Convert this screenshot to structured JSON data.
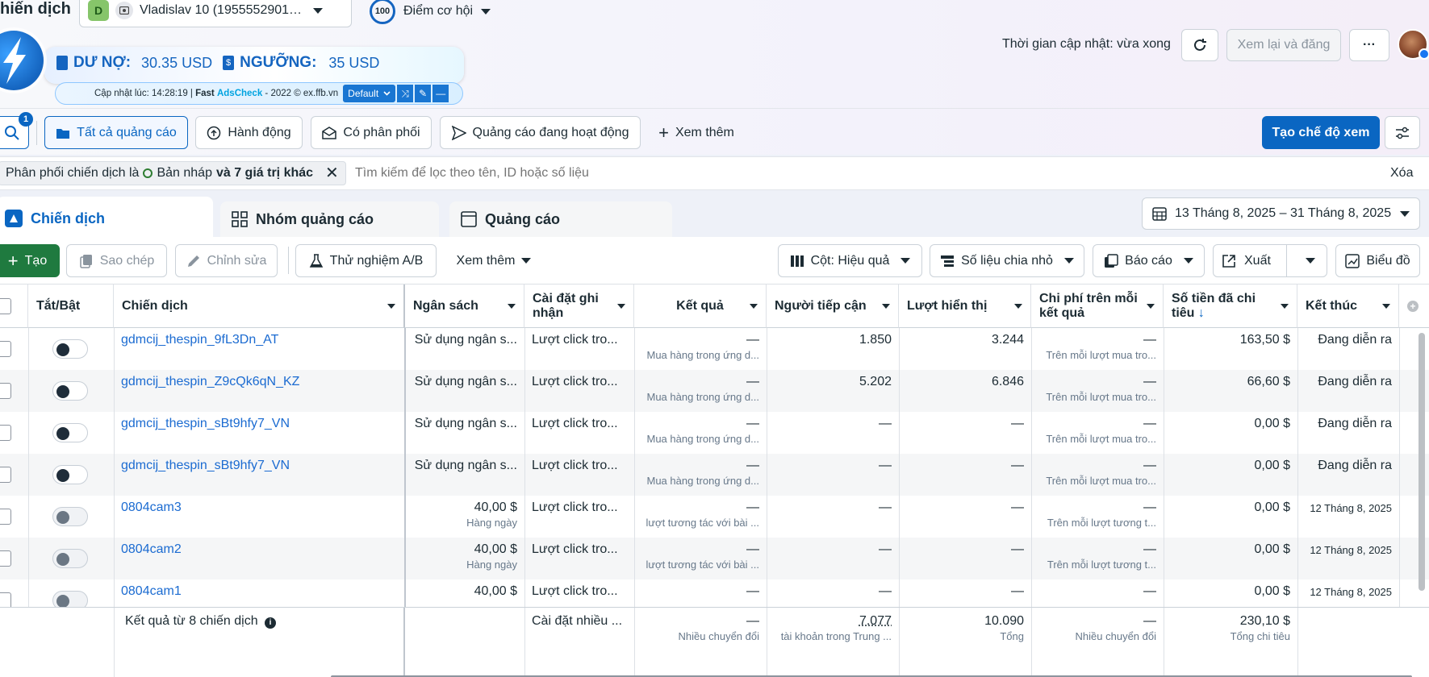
{
  "header": {
    "page_title": "hiến dịch",
    "account_badge": "D",
    "account_name": "Vladislav 10 (1955552901…",
    "score_value": "100",
    "score_label": "Điểm cơ hội",
    "update_time": "Thời gian cập nhật: vừa xong",
    "review_publish": "Xem lại và đăng",
    "more": "···"
  },
  "widget": {
    "debt_label": "DƯ NỢ:",
    "debt_value": "30.35 USD",
    "limit_label": "NGƯỠNG:",
    "limit_value": "35 USD",
    "footer_prefix": "Cập nhật lúc: 14:28:19 | ",
    "footer_fast": "Fast",
    "footer_brand": "AdsCheck",
    "footer_suffix": " - 2022 © ex.ffb.vn",
    "select_value": "Default"
  },
  "filters": {
    "search_badge": "1",
    "all_ads": "Tất cả quảng cáo",
    "actions": "Hành động",
    "delivering": "Có phân phối",
    "active_ads": "Quảng cáo đang hoạt động",
    "see_more": "Xem thêm",
    "create_view": "Tạo chế độ xem"
  },
  "filter_bar": {
    "chip_prefix": "Phân phối chiến dịch là",
    "chip_value": "Bản nháp",
    "chip_more": "và 7 giá trị khác",
    "search_placeholder": "Tìm kiếm để lọc theo tên, ID hoặc số liệu",
    "clear": "Xóa"
  },
  "tabs": {
    "campaigns": "Chiến dịch",
    "adsets": "Nhóm quảng cáo",
    "ads": "Quảng cáo",
    "date_range": "13 Tháng 8, 2025 – 31 Tháng 8, 2025"
  },
  "toolbar": {
    "create": "Tạo",
    "duplicate": "Sao chép",
    "edit": "Chỉnh sửa",
    "ab_test": "Thử nghiệm A/B",
    "more": "Xem thêm",
    "columns": "Cột: Hiệu quả",
    "breakdown": "Số liệu chia nhỏ",
    "reports": "Báo cáo",
    "export": "Xuất",
    "charts": "Biểu đồ"
  },
  "columns": {
    "toggle": "Tắt/Bật",
    "campaign": "Chiến dịch",
    "budget": "Ngân sách",
    "attribution": "Cài đặt ghi nhận",
    "results": "Kết quả",
    "reach": "Người tiếp cận",
    "impressions": "Lượt hiển thị",
    "cost_per_result": "Chi phí trên mỗi kết quả",
    "amount_spent": "Số tiền đã chi tiêu",
    "ends": "Kết thúc"
  },
  "rows": [
    {
      "on": true,
      "name": "gdmcij_thespin_9fL3Dn_AT",
      "budget": "Sử dụng ngân s...",
      "budget_sub": "",
      "attribution": "Lượt click tro...",
      "results": "—",
      "results_sub": "Mua hàng trong ứng d...",
      "reach": "1.850",
      "impressions": "3.244",
      "cpr": "—",
      "cpr_sub": "Trên mỗi lượt mua tro...",
      "spent": "163,50 $",
      "ends": "Đang diễn ra"
    },
    {
      "on": true,
      "name": "gdmcij_thespin_Z9cQk6qN_KZ",
      "budget": "Sử dụng ngân s...",
      "budget_sub": "",
      "attribution": "Lượt click tro...",
      "results": "—",
      "results_sub": "Mua hàng trong ứng d...",
      "reach": "5.202",
      "impressions": "6.846",
      "cpr": "—",
      "cpr_sub": "Trên mỗi lượt mua tro...",
      "spent": "66,60 $",
      "ends": "Đang diễn ra"
    },
    {
      "on": true,
      "name": "gdmcij_thespin_sBt9hfy7_VN",
      "budget": "Sử dụng ngân s...",
      "budget_sub": "",
      "attribution": "Lượt click tro...",
      "results": "—",
      "results_sub": "Mua hàng trong ứng d...",
      "reach": "—",
      "impressions": "—",
      "cpr": "—",
      "cpr_sub": "Trên mỗi lượt mua tro...",
      "spent": "0,00 $",
      "ends": "Đang diễn ra"
    },
    {
      "on": true,
      "name": "gdmcij_thespin_sBt9hfy7_VN",
      "budget": "Sử dụng ngân s...",
      "budget_sub": "",
      "attribution": "Lượt click tro...",
      "results": "—",
      "results_sub": "Mua hàng trong ứng d...",
      "reach": "—",
      "impressions": "—",
      "cpr": "—",
      "cpr_sub": "Trên mỗi lượt mua tro...",
      "spent": "0,00 $",
      "ends": "Đang diễn ra"
    },
    {
      "on": false,
      "name": "0804cam3",
      "budget": "40,00 $",
      "budget_sub": "Hàng ngày",
      "attribution": "Lượt click tro...",
      "results": "—",
      "results_sub": "lượt tương tác với bài ...",
      "reach": "—",
      "impressions": "—",
      "cpr": "—",
      "cpr_sub": "Trên mỗi lượt tương t...",
      "spent": "0,00 $",
      "ends": "12 Tháng 8, 2025"
    },
    {
      "on": false,
      "name": "0804cam2",
      "budget": "40,00 $",
      "budget_sub": "Hàng ngày",
      "attribution": "Lượt click tro...",
      "results": "—",
      "results_sub": "lượt tương tác với bài ...",
      "reach": "—",
      "impressions": "—",
      "cpr": "—",
      "cpr_sub": "Trên mỗi lượt tương t...",
      "spent": "0,00 $",
      "ends": "12 Tháng 8, 2025"
    },
    {
      "on": false,
      "name": "0804cam1",
      "budget": "40,00 $",
      "budget_sub": "",
      "attribution": "Lượt click tro...",
      "results": "—",
      "results_sub": "",
      "reach": "—",
      "impressions": "—",
      "cpr": "—",
      "cpr_sub": "",
      "spent": "0,00 $",
      "ends": "12 Tháng 8, 2025"
    }
  ],
  "summary": {
    "label": "Kết quả từ 8 chiến dịch",
    "attribution": "Cài đặt nhiều ...",
    "results": "—",
    "results_sub": "Nhiều chuyển đổi",
    "reach": "7.077",
    "reach_sub": "tài khoản trong Trung ...",
    "impressions": "10.090",
    "impressions_sub": "Tổng",
    "cpr": "—",
    "cpr_sub": "Nhiều chuyển đổi",
    "spent": "230,10 $",
    "spent_sub": "Tổng chi tiêu"
  },
  "colors": {
    "primary": "#0a66c2",
    "create_green": "#1f7a3f",
    "widget_blue": "#1565c0",
    "link": "#1b6bd1"
  }
}
